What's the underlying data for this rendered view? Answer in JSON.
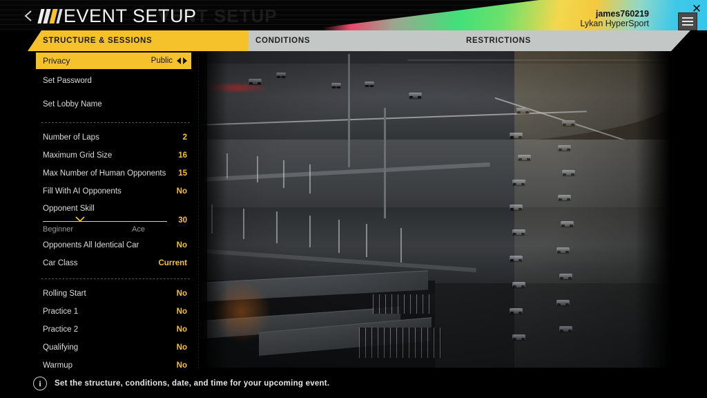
{
  "header": {
    "title": "EVENT SETUP",
    "ghost_title": "EVENT SETUP",
    "back_icon": "back-chevron-icon",
    "logo_icon": "project-cars-logo-icon",
    "menu_icon": "hamburger-menu-icon",
    "close_icon": "close-icon",
    "user_name": "james760219",
    "user_car": "Lykan HyperSport",
    "accent_color": "#f5c22b"
  },
  "tabs": [
    {
      "label": "STRUCTURE & SESSIONS",
      "active": true
    },
    {
      "label": "CONDITIONS",
      "active": false
    },
    {
      "label": "RESTRICTIONS",
      "active": false
    }
  ],
  "settings": {
    "group_lobby": [
      {
        "label": "Privacy",
        "value": "Public",
        "selected": true,
        "has_arrows": true
      },
      {
        "label": "Set Password",
        "value": "",
        "selected": false,
        "has_arrows": false
      },
      {
        "label": "Set Lobby Name",
        "value": "",
        "selected": false,
        "has_arrows": false
      }
    ],
    "group_grid": [
      {
        "label": "Number of Laps",
        "value": "2"
      },
      {
        "label": "Maximum Grid Size",
        "value": "16"
      },
      {
        "label": "Max Number of Human Opponents",
        "value": "15"
      },
      {
        "label": "Fill With AI Opponents",
        "value": "No"
      }
    ],
    "opponent_skill": {
      "label": "Opponent Skill",
      "value": "30",
      "min_label": "Beginner",
      "max_label": "Ace",
      "percent": 30
    },
    "group_cars": [
      {
        "label": "Opponents All Identical Car",
        "value": "No"
      },
      {
        "label": "Car Class",
        "value": "Current"
      }
    ],
    "group_sessions": [
      {
        "label": "Rolling Start",
        "value": "No"
      },
      {
        "label": "Practice 1",
        "value": "No"
      },
      {
        "label": "Practice 2",
        "value": "No"
      },
      {
        "label": "Qualifying",
        "value": "No"
      },
      {
        "label": "Warmup",
        "value": "No"
      }
    ]
  },
  "footer": {
    "info_icon": "info-icon",
    "text": "Set the structure, conditions, date, and time for your upcoming event."
  }
}
